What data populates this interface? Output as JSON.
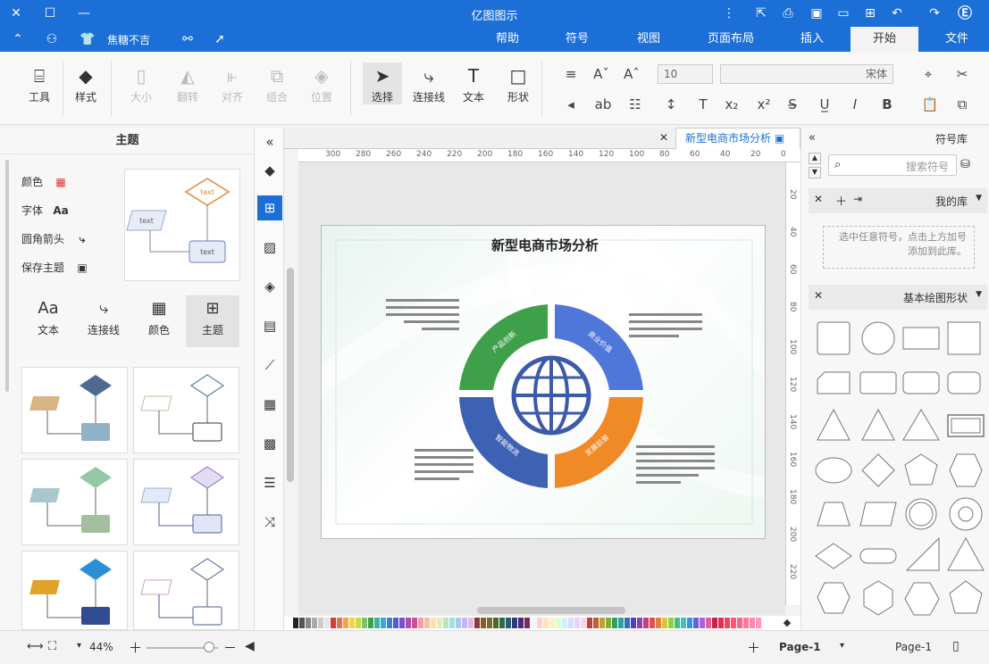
{
  "app": {
    "title": "亿图图示"
  },
  "window_controls": {
    "close": "✕",
    "maximize": "☐",
    "minimize": "—"
  },
  "menu": {
    "tabs": [
      {
        "label": "帮助"
      },
      {
        "label": "符号"
      },
      {
        "label": "视图"
      },
      {
        "label": "页面布局"
      },
      {
        "label": "插入"
      },
      {
        "label": "开始"
      },
      {
        "label": "文件"
      }
    ],
    "active": "开始",
    "user_label": "焦糖不吉"
  },
  "ribbon": {
    "tools": {
      "label": "工具"
    },
    "style": {
      "label": "样式"
    },
    "size": {
      "label": "大小"
    },
    "rotate": {
      "label": "翻转"
    },
    "align": {
      "label": "对齐"
    },
    "group": {
      "label": "组合"
    },
    "position": {
      "label": "位置"
    },
    "select": {
      "label": "选择"
    },
    "connector": {
      "label": "连接线"
    },
    "text": {
      "label": "文本"
    },
    "shape": {
      "label": "形状"
    },
    "font_size": "10",
    "font_name": "宋体"
  },
  "left_panel": {
    "title": "主题",
    "links": [
      {
        "label": "颜色"
      },
      {
        "label": "字体"
      },
      {
        "label": "圆角箭头"
      },
      {
        "label": "保存主题"
      }
    ],
    "tools": [
      {
        "label": "主题"
      },
      {
        "label": "颜色"
      },
      {
        "label": "连接线"
      },
      {
        "label": "文本"
      }
    ],
    "preview_texts": [
      "text",
      "text",
      "text"
    ]
  },
  "document": {
    "tab_title": "新型电商市场分析",
    "diagram_title": "新型电商市场分析",
    "segments": [
      {
        "label": "产品创新"
      },
      {
        "label": "商业价值"
      },
      {
        "label": "发展前景"
      },
      {
        "label": "智能物流"
      }
    ]
  },
  "rulers": {
    "h_ticks": [
      "0",
      "20",
      "40",
      "60",
      "80",
      "100",
      "120",
      "140",
      "160",
      "180",
      "200",
      "220",
      "240",
      "260",
      "280",
      "300"
    ],
    "v_ticks": [
      "20",
      "40",
      "60",
      "80",
      "100",
      "120",
      "140",
      "160",
      "180",
      "200",
      "220"
    ]
  },
  "right_panel": {
    "title": "符号库",
    "search_placeholder": "搜索符号",
    "my_library": "我的库",
    "drop_hint": "选中任意符号，点击上方加号添加到此库。",
    "basic_shapes": "基本绘图形状"
  },
  "status": {
    "page_label": "Page-1",
    "page_tab": "Page-1",
    "zoom": "44%"
  }
}
